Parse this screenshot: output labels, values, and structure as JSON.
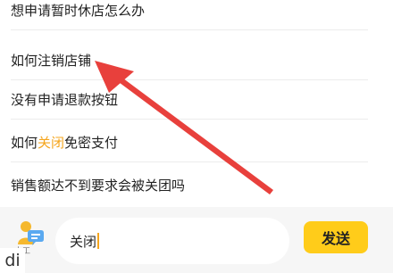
{
  "questions": [
    {
      "text": "想申请暂时休店怎么办"
    },
    {
      "text": "如何注销店铺"
    },
    {
      "text": "没有申请退款按钮"
    },
    {
      "pre": "如何",
      "highlight": "关闭",
      "post": "免密支付"
    },
    {
      "text": "销售额达不到要求会被关团吗"
    }
  ],
  "bottom": {
    "agent_label": "人工",
    "input_value": "关闭",
    "send_label": "发送",
    "overlay_text": "di"
  },
  "colors": {
    "accent": "#ffcc1a",
    "highlight": "#f5a51c",
    "annotation_arrow": "#e8403c"
  },
  "icons": {
    "agent": "customer-service-agent-icon"
  }
}
